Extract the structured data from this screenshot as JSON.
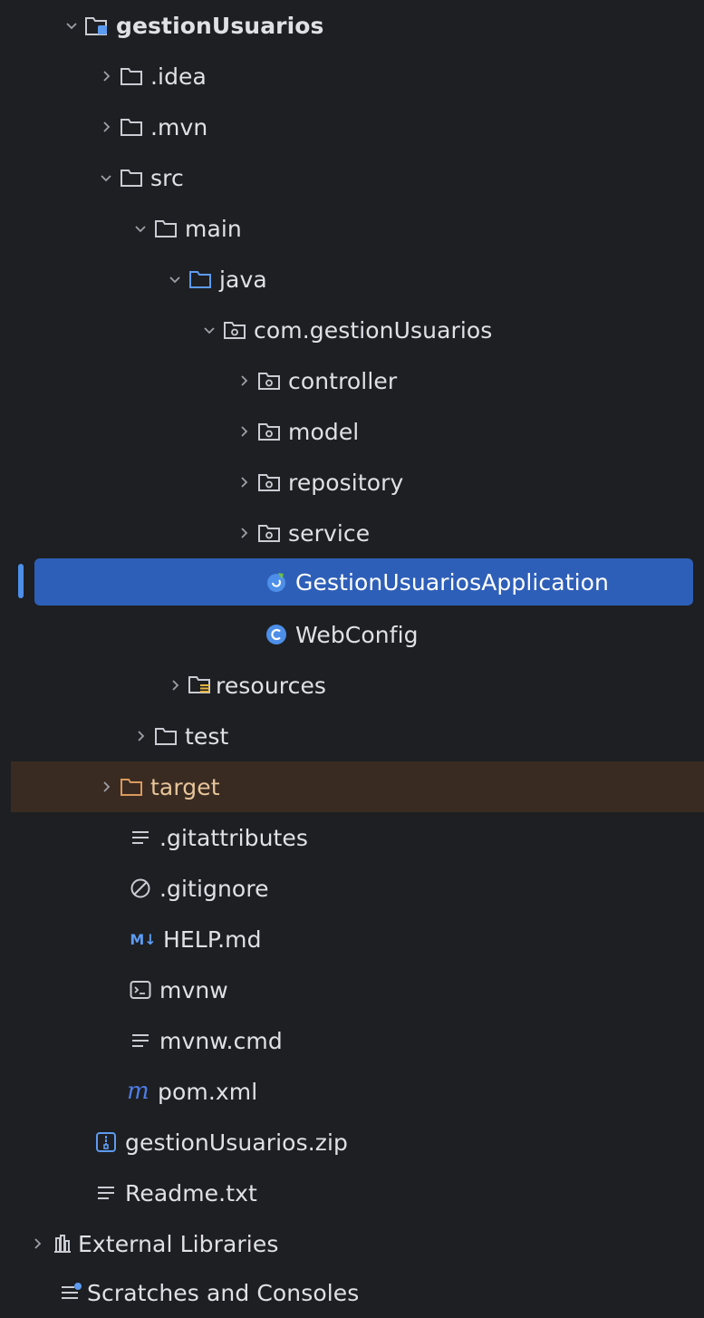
{
  "tree": {
    "root": "gestionUsuarios",
    "idea": ".idea",
    "mvn": ".mvn",
    "src": "src",
    "main": "main",
    "java": "java",
    "package": "com.gestionUsuarios",
    "controller": "controller",
    "model": "model",
    "repository": "repository",
    "service": "service",
    "app_class": "GestionUsuariosApplication",
    "web_config": "WebConfig",
    "resources": "resources",
    "test": "test",
    "target": "target",
    "gitattributes": ".gitattributes",
    "gitignore": ".gitignore",
    "help": "HELP.md",
    "mvnw": "mvnw",
    "mvnw_cmd": "mvnw.cmd",
    "pom": "pom.xml",
    "zip": "gestionUsuarios.zip",
    "readme": "Readme.txt",
    "external_libraries": "External Libraries",
    "scratches": "Scratches and Consoles",
    "md_badge": "M↓"
  },
  "colors": {
    "background": "#1e1f22",
    "selection": "#2e5fb8",
    "excluded": "#3a2b22",
    "folder": "#c9ccd3",
    "source_folder": "#5d9bf0",
    "excluded_folder": "#d99a5e",
    "class_icon": "#4d8fe8",
    "maven": "#4d7de8"
  }
}
